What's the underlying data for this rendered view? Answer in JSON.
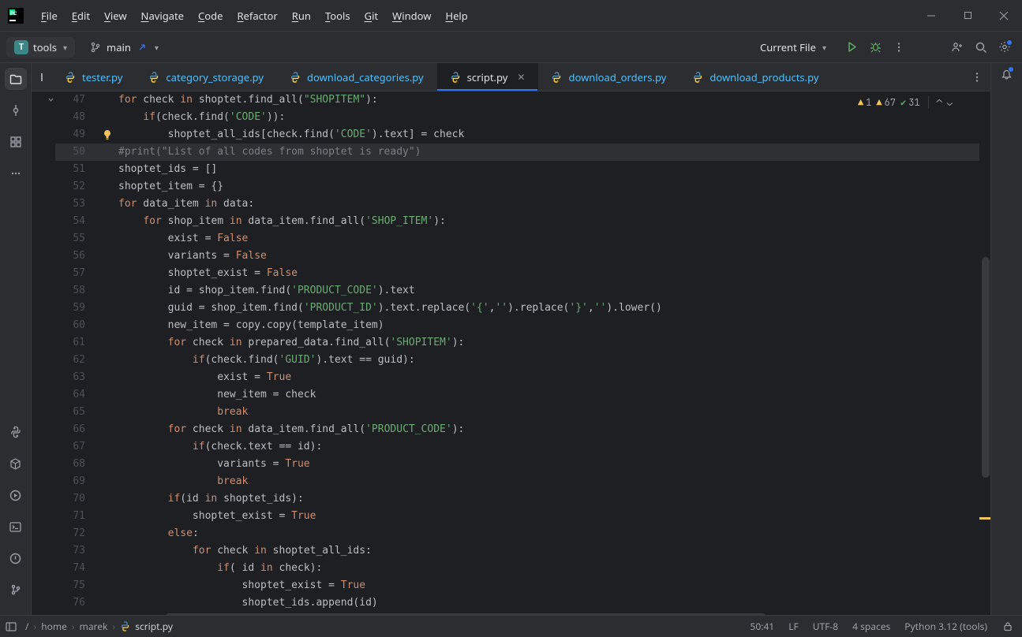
{
  "menu": [
    "File",
    "Edit",
    "View",
    "Navigate",
    "Code",
    "Refactor",
    "Run",
    "Tools",
    "Git",
    "Window",
    "Help"
  ],
  "project_chip": {
    "letter": "T",
    "name": "tools"
  },
  "branch": "main",
  "run_config": "Current File",
  "tabs": [
    {
      "name": "tester.py",
      "active": false,
      "close": false
    },
    {
      "name": "category_storage.py",
      "active": false,
      "close": false
    },
    {
      "name": "download_categories.py",
      "active": false,
      "close": false
    },
    {
      "name": "script.py",
      "active": true,
      "close": true
    },
    {
      "name": "download_orders.py",
      "active": false,
      "close": false
    },
    {
      "name": "download_products.py",
      "active": false,
      "close": false
    }
  ],
  "inspections": {
    "warn1": "1",
    "warn2": "67",
    "ok": "31"
  },
  "line_start": 47,
  "current_line": 50,
  "lamp_line": 49,
  "code": [
    "for check in shoptet.find_all(\"SHOPITEM\"):",
    "    if(check.find('CODE')):",
    "        shoptet_all_ids[check.find('CODE').text] = check",
    "#print(\"List of all codes from shoptet is ready\")",
    "shoptet_ids = []",
    "shoptet_item = {}",
    "for data_item in data:",
    "    for shop_item in data_item.find_all('SHOP_ITEM'):",
    "        exist = False",
    "        variants = False",
    "        shoptet_exist = False",
    "        id = shop_item.find('PRODUCT_CODE').text",
    "        guid = shop_item.find('PRODUCT_ID').text.replace('{','').replace('}','').lower()",
    "        new_item = copy.copy(template_item)",
    "        for check in prepared_data.find_all('SHOPITEM'):",
    "            if(check.find('GUID').text == guid):",
    "                exist = True",
    "                new_item = check",
    "                break",
    "        for check in data_item.find_all('PRODUCT_CODE'):",
    "            if(check.text == id):",
    "                variants = True",
    "                break",
    "        if(id in shoptet_ids):",
    "            shoptet_exist = True",
    "        else:",
    "            for check in shoptet_all_ids:",
    "                if( id in check):",
    "                    shoptet_exist = True",
    "                    shoptet_ids.append(id)"
  ],
  "breadcrumbs": [
    "home",
    "marek",
    "script.py"
  ],
  "status": {
    "pos": "50:41",
    "eol": "LF",
    "enc": "UTF-8",
    "indent": "4 spaces",
    "interp": "Python 3.12 (tools)"
  }
}
